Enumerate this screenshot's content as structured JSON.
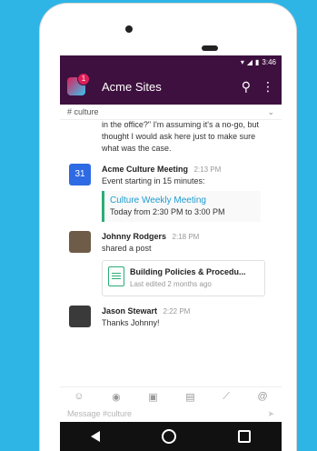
{
  "status": {
    "time": "3:46"
  },
  "appbar": {
    "workspace": "Acme Sites",
    "badge_count": "1"
  },
  "channel": {
    "name": "# culture"
  },
  "messages": {
    "first_text": "in the office?\" I'm assuming it's a no-go, but thought I would ask here just to make sure what was the case.",
    "calendar": {
      "icon_label": "31",
      "name": "Acme Culture Meeting",
      "time": "2:13 PM",
      "text": "Event starting in 15 minutes:",
      "event_title": "Culture Weekly Meeting",
      "event_time": "Today from 2:30 PM to 3:00 PM"
    },
    "johnny": {
      "name": "Johnny Rodgers",
      "time": "2:18 PM",
      "text": "shared a post",
      "doc_title": "Building Policies & Procedu...",
      "doc_meta": "Last edited 2 months ago"
    },
    "jason": {
      "name": "Jason Stewart",
      "time": "2:22 PM",
      "text": "Thanks Johnny!"
    }
  },
  "toolbar": {
    "icons": [
      "emoji-icon",
      "camera-icon",
      "gallery-icon",
      "file-icon",
      "slash-icon",
      "mention-icon"
    ]
  },
  "composer": {
    "placeholder": "Message #culture"
  }
}
